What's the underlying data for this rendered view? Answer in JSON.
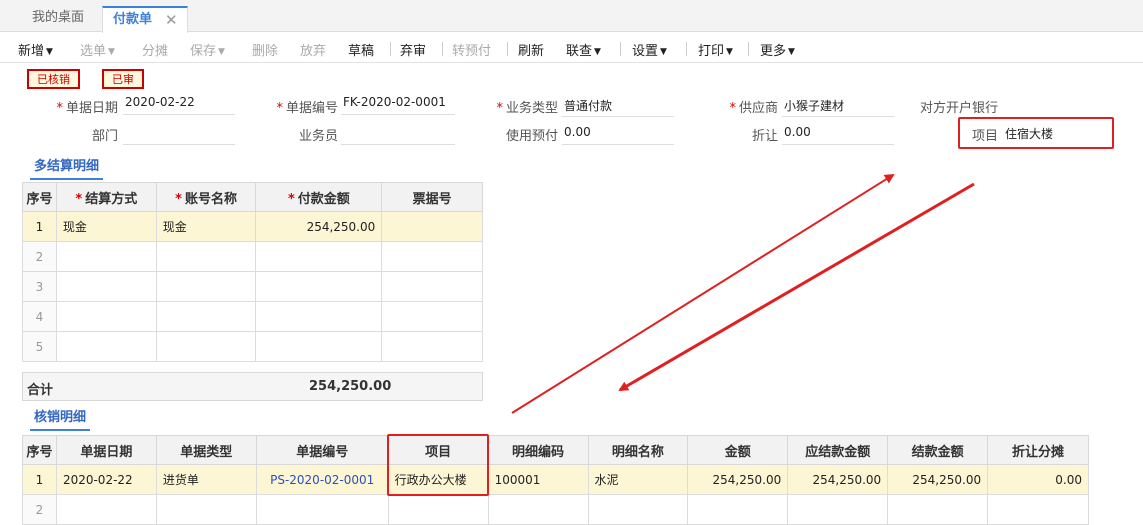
{
  "tabs": {
    "home": "我的桌面",
    "active": "付款单",
    "close": "✕"
  },
  "toolbar": {
    "new": "新增",
    "select": "选单",
    "split": "分摊",
    "save": "保存",
    "delete": "删除",
    "discard": "放弃",
    "draft": "草稿",
    "unaudit": "弃审",
    "to_prepay": "转预付",
    "refresh": "刷新",
    "related": "联查",
    "settings": "设置",
    "print": "打印",
    "more": "更多"
  },
  "badges": {
    "verified": "已核销",
    "audited": "已审"
  },
  "form": {
    "date_label": "单据日期",
    "date_value": "2020-02-22",
    "doc_no_label": "单据编号",
    "doc_no_value": "FK-2020-02-0001",
    "biz_type_label": "业务类型",
    "biz_type_value": "普通付款",
    "supplier_label": "供应商",
    "supplier_value": "小猴子建材",
    "bank_label": "对方开户银行",
    "dept_label": "部门",
    "dept_value": "",
    "staff_label": "业务员",
    "staff_value": "",
    "prepay_label": "使用预付",
    "prepay_value": "0.00",
    "discount_label": "折让",
    "discount_value": "0.00",
    "project_label": "项目",
    "project_value": "住宿大楼"
  },
  "settlement": {
    "title": "多结算明细",
    "headers": [
      "序号",
      "结算方式",
      "账号名称",
      "付款金额",
      "票据号"
    ],
    "rows": [
      [
        "1",
        "现金",
        "现金",
        "254,250.00",
        ""
      ],
      [
        "2",
        "",
        "",
        "",
        ""
      ],
      [
        "3",
        "",
        "",
        "",
        ""
      ],
      [
        "4",
        "",
        "",
        "",
        ""
      ],
      [
        "5",
        "",
        "",
        "",
        ""
      ]
    ],
    "total_label": "合计",
    "total_value": "254,250.00"
  },
  "writeoff": {
    "title": "核销明细",
    "headers": [
      "序号",
      "单据日期",
      "单据类型",
      "单据编号",
      "项目",
      "明细编码",
      "明细名称",
      "金额",
      "应结款金额",
      "结款金额",
      "折让分摊"
    ],
    "rows": [
      [
        "1",
        "2020-02-22",
        "进货单",
        "PS-2020-02-0001",
        "行政办公大楼",
        "100001",
        "水泥",
        "254,250.00",
        "254,250.00",
        "254,250.00",
        "0.00"
      ],
      [
        "2",
        "",
        "",
        "",
        "",
        "",
        "",
        "",
        "",
        "",
        ""
      ]
    ]
  },
  "colors": {
    "accent": "#3b82d8",
    "highlight": "#e02020",
    "row_highlight": "#fdf6d4"
  }
}
